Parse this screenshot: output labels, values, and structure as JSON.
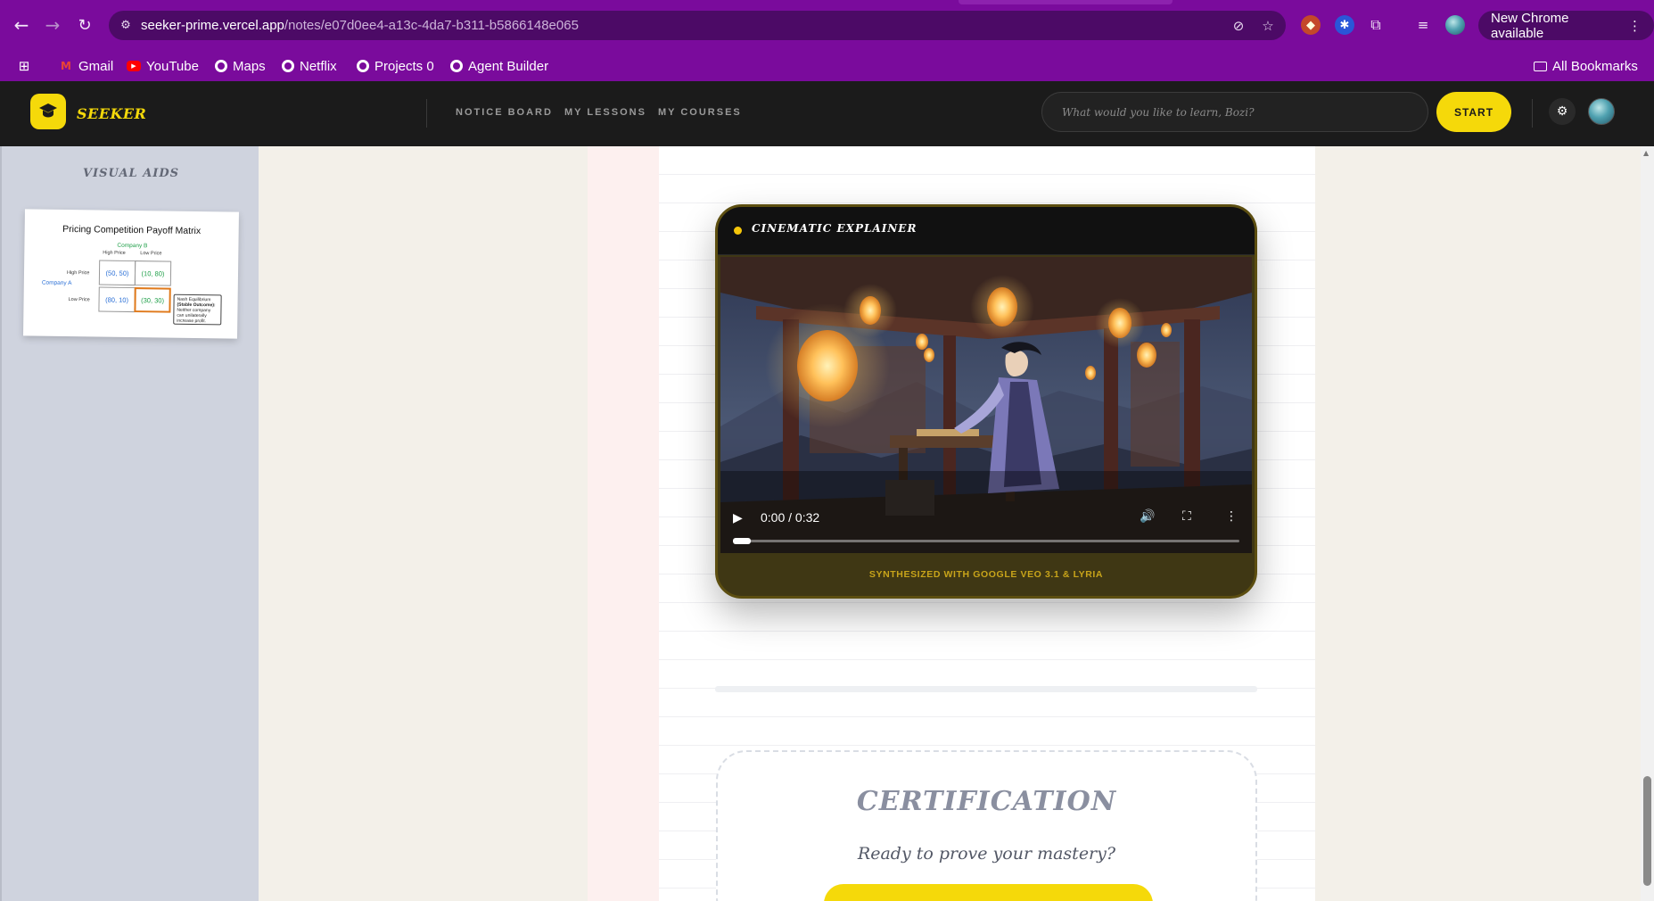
{
  "browser": {
    "url_host": "seeker-prime.vercel.app",
    "url_path": "/notes/e07d0ee4-a13c-4da7-b311-b5866148e065",
    "new_chrome_label": "New Chrome available",
    "bookmarks": [
      {
        "label": "Gmail",
        "icon": "gmail-icon"
      },
      {
        "label": "YouTube",
        "icon": "youtube-icon"
      },
      {
        "label": "Maps",
        "icon": "globe-icon"
      },
      {
        "label": "Netflix",
        "icon": "globe-icon"
      },
      {
        "label": "Projects 0",
        "icon": "globe-icon"
      },
      {
        "label": "Agent Builder",
        "icon": "globe-icon"
      }
    ],
    "all_bookmarks_label": "All Bookmarks",
    "theme_color": "#7a0b9c"
  },
  "app": {
    "brand": "SEEKER",
    "nav": [
      "NOTICE BOARD",
      "MY LESSONS",
      "MY COURSES"
    ],
    "search_placeholder": "What would you like to learn, Bozi?",
    "start_label": "START",
    "accent_color": "#f5d90a"
  },
  "sidebar": {
    "title": "VISUAL AIDS",
    "matrix": {
      "title": "Pricing Competition Payoff Matrix",
      "company_b": "Company B",
      "company_a": "Company A",
      "col_headers": [
        "High Price",
        "Low Price"
      ],
      "row_headers": [
        "High Price",
        "Low Price"
      ],
      "cells": [
        [
          "(50, 50)",
          "(10, 80)"
        ],
        [
          "(80, 10)",
          "(30, 30)"
        ]
      ],
      "nash_title": "Nash Equilibrium",
      "nash_sub": "(Stable Outcome):",
      "nash_text": "Neither company can unilaterally increase profit."
    }
  },
  "video": {
    "title": "CINEMATIC EXPLAINER",
    "time": "0:00 / 0:32",
    "progress": 0.0,
    "footer": "SYNTHESIZED WITH GOOGLE VEO 3.1 & LYRIA"
  },
  "certification": {
    "title": "CERTIFICATION",
    "subtitle": "Ready to prove your mastery?"
  }
}
